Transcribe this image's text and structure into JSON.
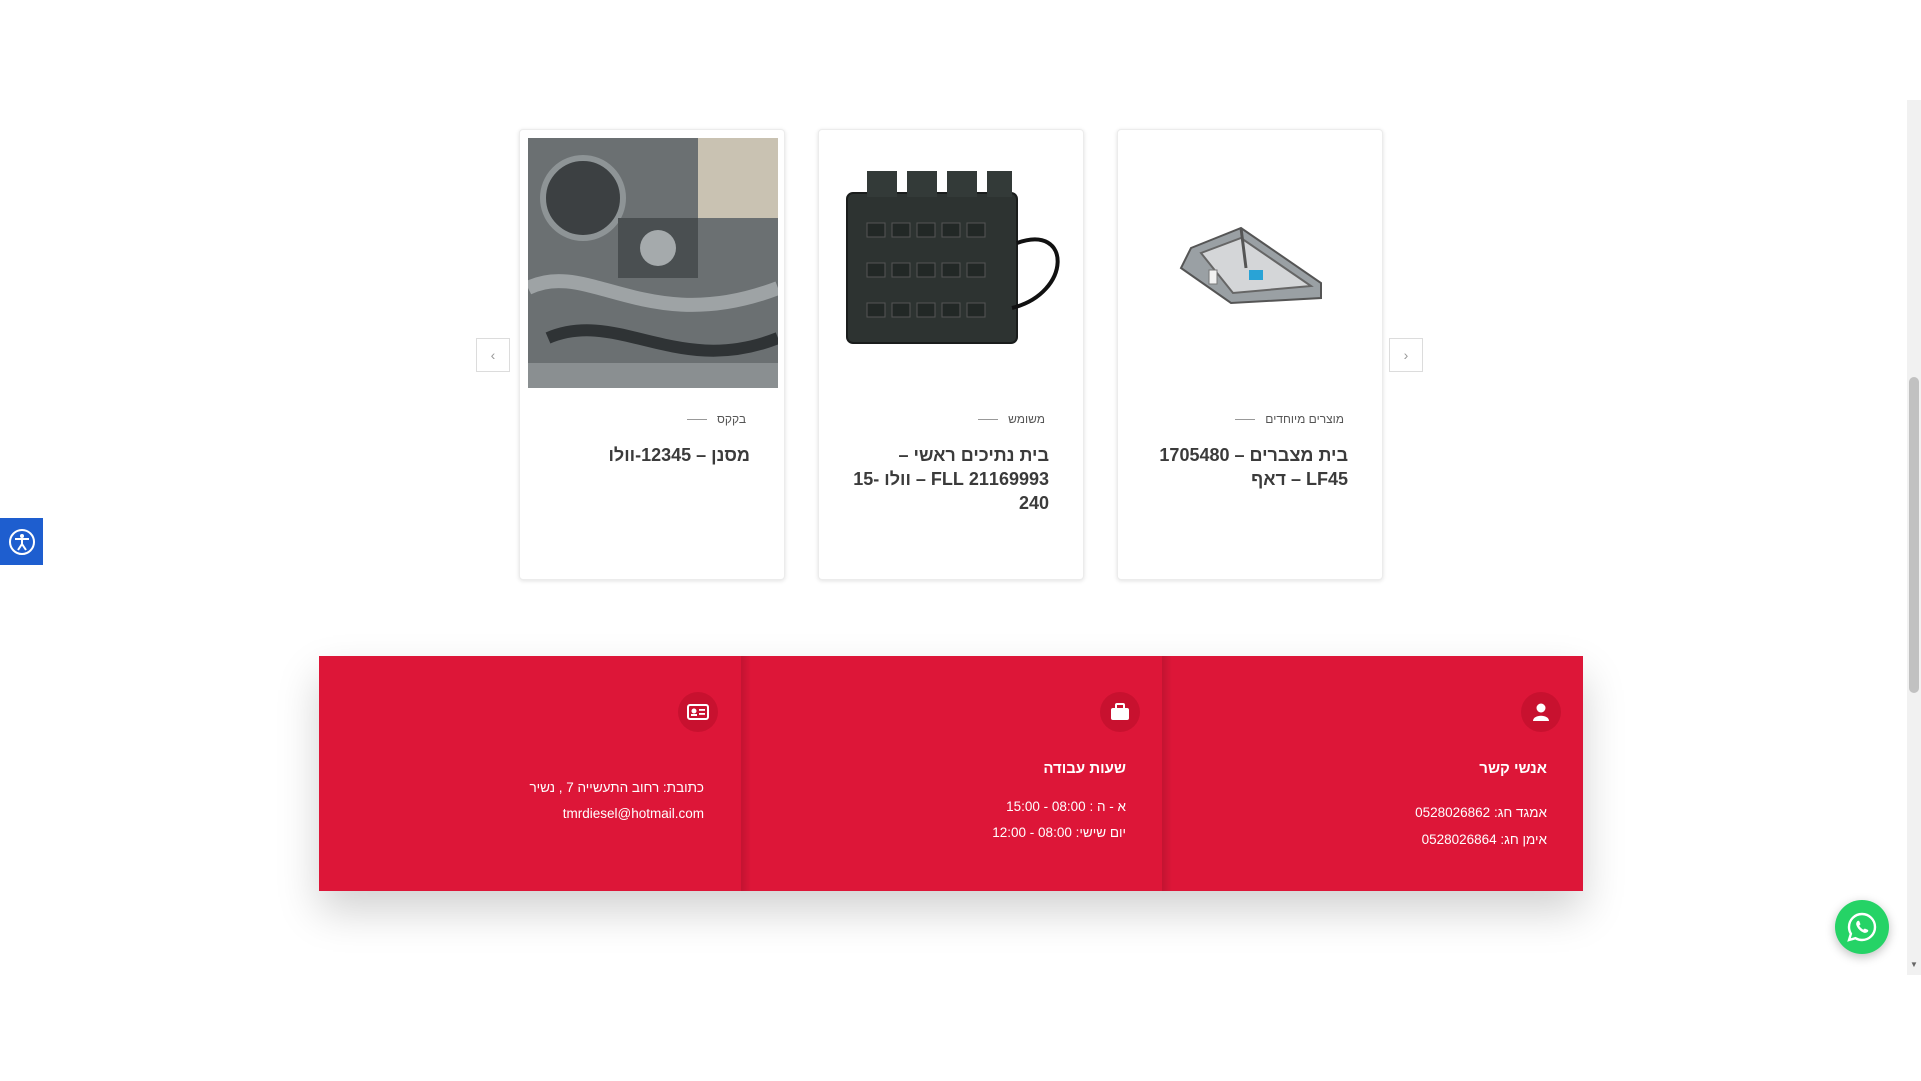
{
  "products": [
    {
      "category": "מוצרים מיוחדים",
      "title": "בית מצברים – 1705480 LF45 – דאף"
    },
    {
      "category": "משומש",
      "title": "בית נתיכים ראשי – 21169993 FLL – וולו 15-240"
    },
    {
      "category": "בקקס",
      "title": "מסנן – 12345-וולו"
    }
  ],
  "carousel": {
    "next_icon": "chevron-right-icon",
    "prev_icon": "chevron-left-icon"
  },
  "contact": {
    "people": {
      "heading": "אנשי קשר",
      "line1": "אמגד חג: 0528026862",
      "line2": "אימן חג: 0528026864"
    },
    "hours": {
      "heading": "שעות עבודה",
      "line1": "א - ה : 08:00 - 15:00",
      "line2": "יום שישי: 08:00 - 12:00"
    },
    "address": {
      "line1": "כתובת: רחוב התעשייה 7 , נשיר",
      "line2": "tmrdiesel@hotmail.com"
    }
  },
  "colors": {
    "brand_red": "#dd1638",
    "whatsapp_green": "#25d366",
    "accessibility_blue": "#1e5ecf"
  }
}
